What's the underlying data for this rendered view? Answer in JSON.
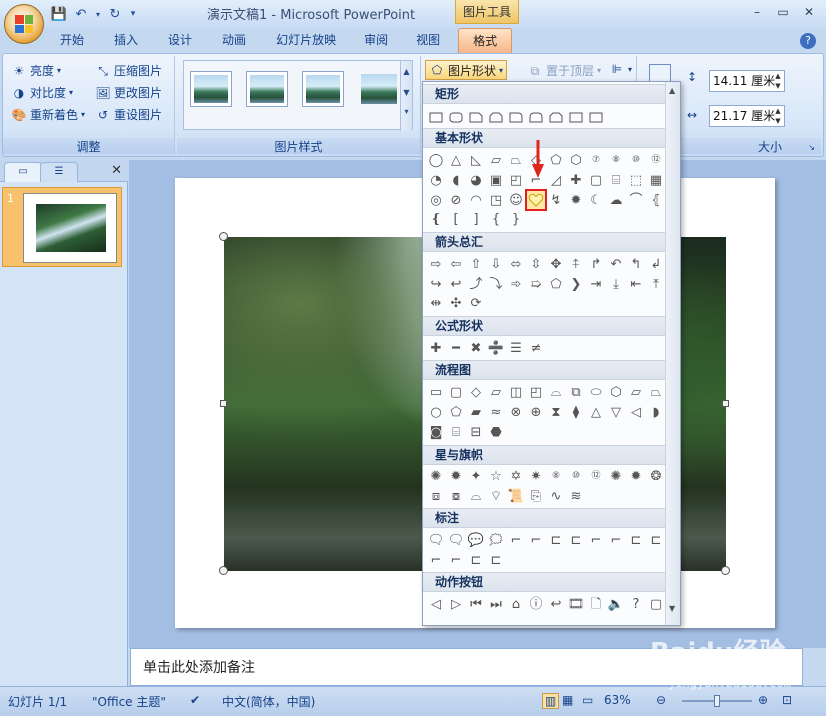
{
  "window": {
    "title": "演示文稿1 - Microsoft PowerPoint",
    "context_tab_group": "图片工具",
    "controls": [
      "–",
      "▭",
      "✕"
    ]
  },
  "tabs": [
    {
      "label": "开始"
    },
    {
      "label": "插入"
    },
    {
      "label": "设计"
    },
    {
      "label": "动画"
    },
    {
      "label": "幻灯片放映"
    },
    {
      "label": "审阅"
    },
    {
      "label": "视图"
    },
    {
      "label": "格式"
    }
  ],
  "ribbon": {
    "adjust": {
      "label": "调整",
      "brightness": "亮度",
      "contrast": "对比度",
      "recolor": "重新着色",
      "compress": "压缩图片",
      "change": "更改图片",
      "reset": "重设图片"
    },
    "styles": {
      "label": "图片样式"
    },
    "picture_shape": "图片形状",
    "bring_front": "置于顶层",
    "size": {
      "label": "大小",
      "height": "14.11 厘米",
      "width": "21.17 厘米"
    }
  },
  "dropdown": {
    "sections": [
      "矩形",
      "基本形状",
      "箭头总汇",
      "公式形状",
      "流程图",
      "星与旗帜",
      "标注",
      "动作按钮"
    ],
    "equation_shapes": [
      "✚",
      "━",
      "✖",
      "➗",
      "☰",
      "≠"
    ],
    "highlighted_shape": "heart"
  },
  "left_panel": {
    "slide_number": "1"
  },
  "notes": {
    "placeholder": "单击此处添加备注"
  },
  "status": {
    "slide": "幻灯片 1/1",
    "theme": "\"Office 主题\"",
    "language": "中文(简体，中国)",
    "zoom": "63%"
  },
  "watermark": {
    "brand": "Baidu经验",
    "url": "jingyan.baidu.com"
  }
}
